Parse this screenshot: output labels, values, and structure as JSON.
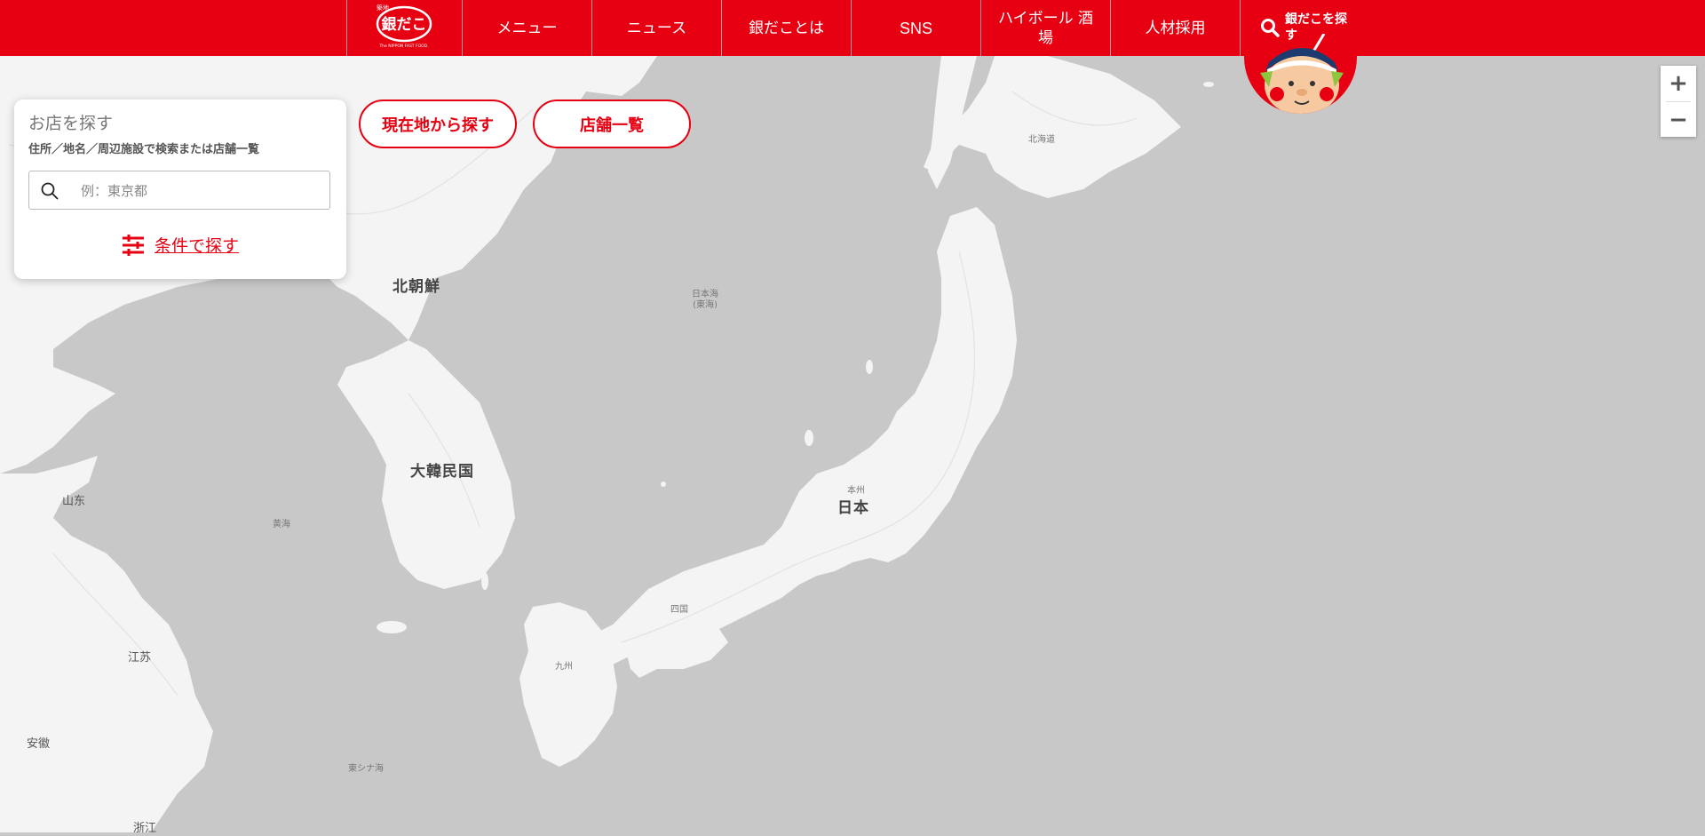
{
  "header": {
    "logo_text": "築地 銀だこ GINDACO The NIPPON FAST FOOD.",
    "nav": [
      {
        "label": "メニュー"
      },
      {
        "label": "ニュース"
      },
      {
        "label": "銀だことは"
      },
      {
        "label": "SNS"
      },
      {
        "label": "ハイボール 酒場"
      },
      {
        "label": "人材採用"
      }
    ],
    "find_button_label": "銀だこを探す"
  },
  "search_panel": {
    "title": "お店を探す",
    "subtitle": "住所／地名／周辺施設で検索または店舗一覧",
    "input_placeholder": "例：東京都",
    "input_value": "",
    "condition_link": "条件で探す"
  },
  "buttons": {
    "current_location": "現在地から探す",
    "store_list": "店舗一覧"
  },
  "zoom": {
    "in": "+",
    "out": "−"
  },
  "map_labels": {
    "north_korea": "北朝鮮",
    "south_korea": "大韓民国",
    "japan": "日本",
    "honshu": "本州",
    "hokkaido": "北海道",
    "shikoku": "四国",
    "kyushu": "九州",
    "sea_of_japan": "日本海\n(東海)",
    "yellow_sea": "黄海",
    "east_china_sea": "東シナ海",
    "shandong": "山东",
    "jiangsu": "江苏",
    "anhui": "安徽",
    "zhejiang": "浙江"
  },
  "colors": {
    "brand_red": "#e60012",
    "sea": "#c8c8c8",
    "land": "#f4f4f4"
  }
}
